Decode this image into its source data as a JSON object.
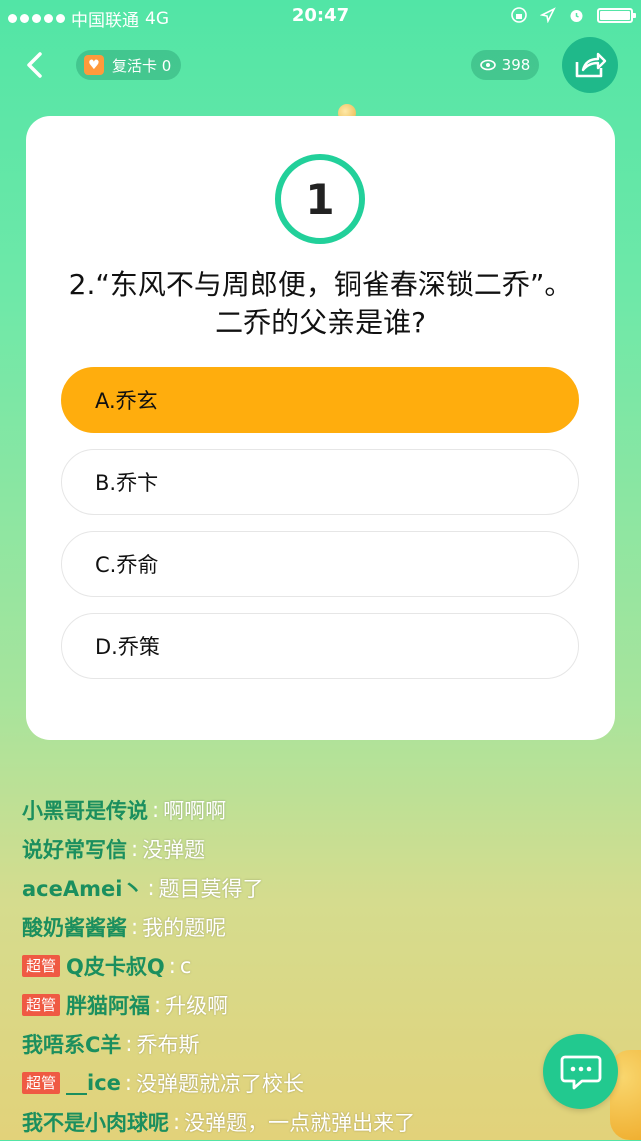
{
  "status_bar": {
    "carrier": "中国联通",
    "network": "4G",
    "time": "20:47"
  },
  "header": {
    "revive_card_label": "复活卡 0",
    "viewer_count": "398"
  },
  "question_card": {
    "countdown": "1",
    "question": "2.“东风不与周郎便，铜雀春深锁二乔”。二乔的父亲是谁?",
    "options": [
      {
        "label": "A.乔玄",
        "selected": true
      },
      {
        "label": "B.乔卞",
        "selected": false
      },
      {
        "label": "C.乔俞",
        "selected": false
      },
      {
        "label": "D.乔策",
        "selected": false
      }
    ]
  },
  "chat": [
    {
      "badge": "",
      "user": "小黑哥是传说",
      "message": "啊啊啊"
    },
    {
      "badge": "",
      "user": "说好常写信",
      "message": "没弹题"
    },
    {
      "badge": "",
      "user": "aceAmei丶",
      "message": "题目莫得了"
    },
    {
      "badge": "",
      "user": "酸奶酱酱酱",
      "message": "我的题呢"
    },
    {
      "badge": "超管",
      "user": "Q皮卡叔Q",
      "message": "c"
    },
    {
      "badge": "超管",
      "user": "胖猫阿福",
      "message": "升级啊"
    },
    {
      "badge": "",
      "user": "我唔系C羊",
      "message": "乔布斯"
    },
    {
      "badge": "超管",
      "user": "__ice",
      "message": "没弹题就凉了校长"
    },
    {
      "badge": "",
      "user": "我不是小肉球呢",
      "message": "没弹题，一点就弹出来了"
    }
  ],
  "colors": {
    "accent_green": "#22d09a",
    "selected_option": "#ffad0d",
    "admin_badge": "#ef5a43"
  },
  "icons": [
    "back-arrow-icon",
    "heart-card-icon",
    "eye-icon",
    "share-icon",
    "chat-bubble-icon"
  ]
}
